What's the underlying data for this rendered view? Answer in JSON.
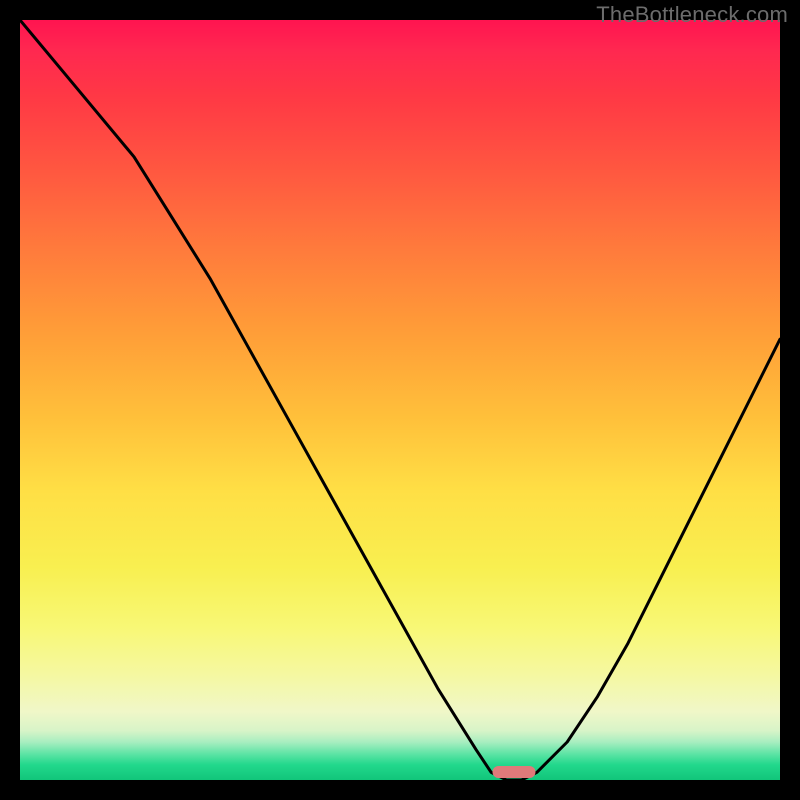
{
  "watermark": "TheBottleneck.com",
  "colors": {
    "background": "#000000",
    "watermark": "#6c6c6c",
    "curve": "#000000",
    "marker": "#df7a7a"
  },
  "chart_data": {
    "type": "line",
    "title": "",
    "xlabel": "",
    "ylabel": "",
    "xlim": [
      0,
      100
    ],
    "ylim": [
      0,
      100
    ],
    "grid": false,
    "legend": false,
    "annotations": [],
    "series": [
      {
        "name": "bottleneck-curve",
        "x": [
          0,
          5,
          10,
          15,
          20,
          25,
          30,
          35,
          40,
          45,
          50,
          55,
          60,
          62,
          64,
          66,
          68,
          72,
          76,
          80,
          84,
          88,
          92,
          96,
          100
        ],
        "values": [
          100,
          94,
          88,
          82,
          74,
          66,
          57,
          48,
          39,
          30,
          21,
          12,
          4,
          1,
          0,
          0,
          1,
          5,
          11,
          18,
          26,
          34,
          42,
          50,
          58
        ]
      }
    ],
    "marker": {
      "x": 65,
      "y": 1
    }
  }
}
